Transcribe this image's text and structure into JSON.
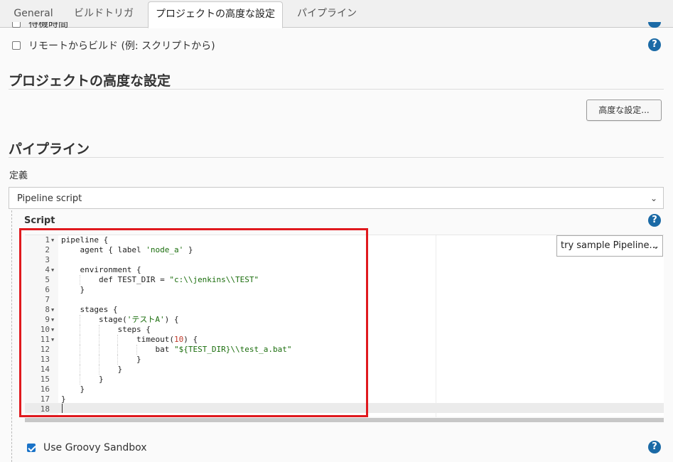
{
  "tabs": [
    {
      "label": "General"
    },
    {
      "label": "ビルドトリガ"
    },
    {
      "label": "プロジェクトの高度な設定"
    },
    {
      "label": "パイプライン"
    }
  ],
  "options": {
    "cutoff_label": "待機時間",
    "remote_build_label": "リモートからビルド (例: スクリプトから)"
  },
  "advanced_section": {
    "title": "プロジェクトの高度な設定",
    "button_label": "高度な設定..."
  },
  "pipeline_section": {
    "title": "パイプライン",
    "definition_label": "定義",
    "definition_value": "Pipeline script",
    "script_label": "Script",
    "sample_select": "try sample Pipeline...",
    "sandbox_label": "Use Groovy Sandbox",
    "sandbox_checked": true
  },
  "code_lines": [
    {
      "n": "1",
      "fold": true,
      "text": "pipeline {"
    },
    {
      "n": "2",
      "fold": false,
      "text": "    agent { label 'node_a' }"
    },
    {
      "n": "3",
      "fold": false,
      "text": ""
    },
    {
      "n": "4",
      "fold": true,
      "text": "    environment {"
    },
    {
      "n": "5",
      "fold": false,
      "text": "        def TEST_DIR = \"c:\\\\jenkins\\\\TEST\""
    },
    {
      "n": "6",
      "fold": false,
      "text": "    }"
    },
    {
      "n": "7",
      "fold": false,
      "text": ""
    },
    {
      "n": "8",
      "fold": true,
      "text": "    stages {"
    },
    {
      "n": "9",
      "fold": true,
      "text": "        stage('テストA') {"
    },
    {
      "n": "10",
      "fold": true,
      "text": "            steps {"
    },
    {
      "n": "11",
      "fold": true,
      "text": "                timeout(10) {"
    },
    {
      "n": "12",
      "fold": false,
      "text": "                    bat \"${TEST_DIR}\\\\test_a.bat\""
    },
    {
      "n": "13",
      "fold": false,
      "text": "                }"
    },
    {
      "n": "14",
      "fold": false,
      "text": "            }"
    },
    {
      "n": "15",
      "fold": false,
      "text": "        }"
    },
    {
      "n": "16",
      "fold": false,
      "text": "    }"
    },
    {
      "n": "17",
      "fold": false,
      "text": "}"
    },
    {
      "n": "18",
      "fold": false,
      "text": ""
    }
  ],
  "colors": {
    "accent": "#1b6aa6",
    "highlight_box": "#e0191e",
    "string": "#1a6d0c"
  }
}
